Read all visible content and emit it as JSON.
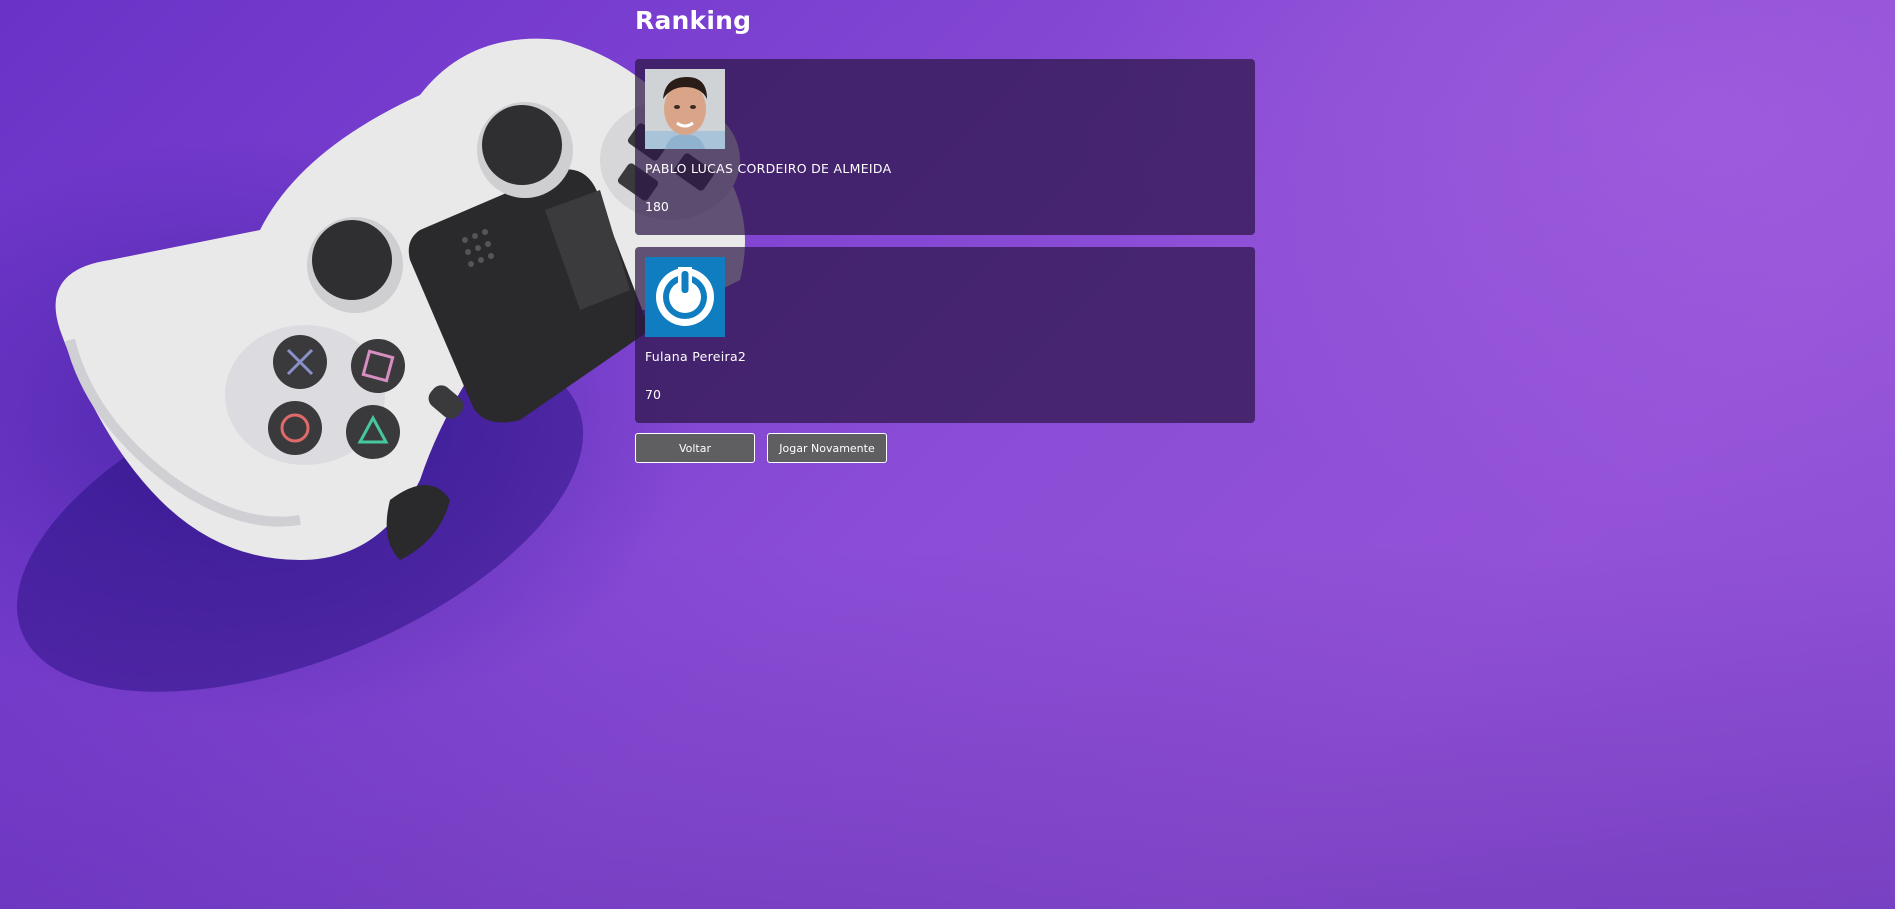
{
  "page": {
    "title": "Ranking"
  },
  "ranking": [
    {
      "name": "PABLO LUCAS CORDEIRO DE ALMEIDA",
      "score": "180",
      "avatar": "photo-avatar"
    },
    {
      "name": "Fulana Pereira2",
      "score": "70",
      "avatar": "power-icon-avatar"
    }
  ],
  "actions": {
    "back_label": "Voltar",
    "play_again_label": "Jogar Novamente"
  },
  "colors": {
    "background": "#8548d2",
    "card": "#2d1646",
    "button": "#5f5f62",
    "avatar_blue": "#0f7dc0"
  }
}
